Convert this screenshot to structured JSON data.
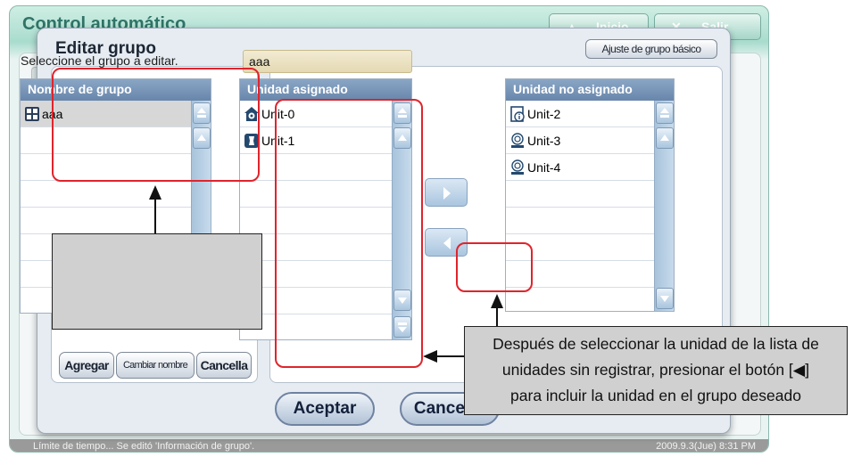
{
  "app": {
    "title": "Control automático",
    "home_label": "Inicio",
    "exit_label": "Salir"
  },
  "status_bar": {
    "message": "Límite de tiempo... Se editó 'Información de grupo'.",
    "datetime": "2009.9.3(Jue)  8:31 PM"
  },
  "dialog": {
    "title": "Editar grupo",
    "basic_group_button": "Ajuste de grupo básico",
    "hint": "Seleccione el grupo a editar.",
    "group_name_value": "aaa",
    "group_list": {
      "header": "Nombre de grupo",
      "rows": [
        "aaa",
        "",
        "",
        "",
        "",
        "",
        "",
        ""
      ]
    },
    "assigned_list": {
      "header": "Unidad asignado",
      "rows": [
        "Unit-0",
        "Unit-1",
        "",
        "",
        "",
        "",
        "",
        "",
        ""
      ],
      "icons": [
        "indoor-unit-icon",
        "duct-unit-icon"
      ]
    },
    "unassigned_list": {
      "header": "Unidad no asignado",
      "rows": [
        "Unit-2",
        "Unit-3",
        "Unit-4",
        "",
        "",
        "",
        "",
        ""
      ],
      "icons": [
        "info-unit-icon",
        "awhp-unit-icon",
        "awhp-unit-icon"
      ]
    },
    "buttons": {
      "add": "Agregar",
      "rename": "Cambiar nombre",
      "cancel_small": "Cancella",
      "accept": "Aceptar",
      "cancel": "Cancelar"
    }
  },
  "annotation": {
    "text_lines": [
      "Después de seleccionar la unidad de la lista de",
      "unidades sin registrar, presionar el botón [◀]",
      "para incluir la unidad en el grupo deseado"
    ],
    "highlight_color": "#e0242c"
  }
}
